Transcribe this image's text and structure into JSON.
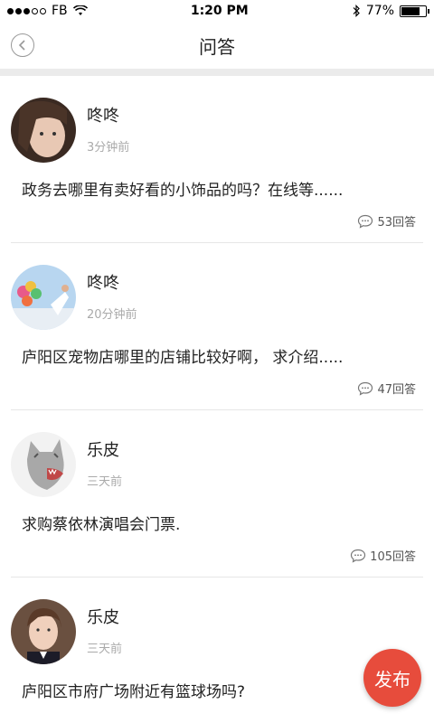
{
  "status_bar": {
    "carrier": "FB",
    "time": "1:20 PM",
    "battery": "77%",
    "battery_level": 0.77
  },
  "header": {
    "title": "问答"
  },
  "posts": [
    {
      "user": "咚咚",
      "time": "3分钟前",
      "question": "政务去哪里有卖好看的小饰品的吗？在线等......",
      "replies": "53回答"
    },
    {
      "user": "咚咚",
      "time": "20分钟前",
      "question": "庐阳区宠物店哪里的店铺比较好啊，  求介绍.....",
      "replies": "47回答"
    },
    {
      "user": "乐皮",
      "time": "三天前",
      "question": "求购蔡依林演唱会门票.",
      "replies": "105回答"
    },
    {
      "user": "乐皮",
      "time": "三天前",
      "question": "庐阳区市府广场附近有篮球场吗?",
      "replies": ""
    }
  ],
  "fab": {
    "label": "发布"
  },
  "colors": {
    "accent": "#e74c3c",
    "divider": "#ebebeb"
  }
}
